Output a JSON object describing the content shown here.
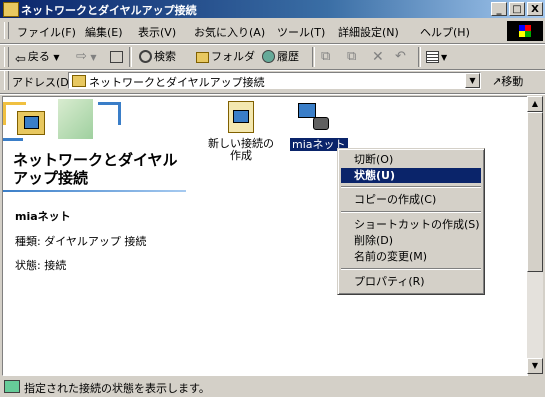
{
  "window": {
    "title": "ネットワークとダイヤルアップ接続",
    "minimize": "_",
    "maximize": "□",
    "close": "X"
  },
  "menubar": {
    "items": [
      "ファイル(F)",
      "編集(E)",
      "表示(V)",
      "お気に入り(A)",
      "ツール(T)",
      "詳細設定(N)",
      "ヘルプ(H)"
    ]
  },
  "toolbar": {
    "back": "戻る",
    "search": "検索",
    "folders": "フォルダ",
    "history": "履歴"
  },
  "address": {
    "label": "アドレス(D)",
    "value": "ネットワークとダイヤルアップ接続",
    "go": "移動"
  },
  "sidepanel": {
    "title": "ネットワークとダイヤルアップ接続",
    "selected_name": "miaネット",
    "type_line": "種類: ダイヤルアップ 接続",
    "status_line": "状態: 接続"
  },
  "icons": [
    {
      "label": "新しい接続の作成"
    },
    {
      "label": "miaネット"
    }
  ],
  "context_menu": {
    "items": [
      "切断(O)",
      "状態(U)",
      "コピーの作成(C)",
      "ショートカットの作成(S)",
      "削除(D)",
      "名前の変更(M)",
      "プロパティ(R)"
    ],
    "selected": "状態(U)"
  },
  "statusbar": {
    "text": "指定された接続の状態を表示します。"
  },
  "colors": {
    "titlebar": "#0a246a",
    "selection": "#0a246a",
    "face": "#d4d0c8"
  }
}
